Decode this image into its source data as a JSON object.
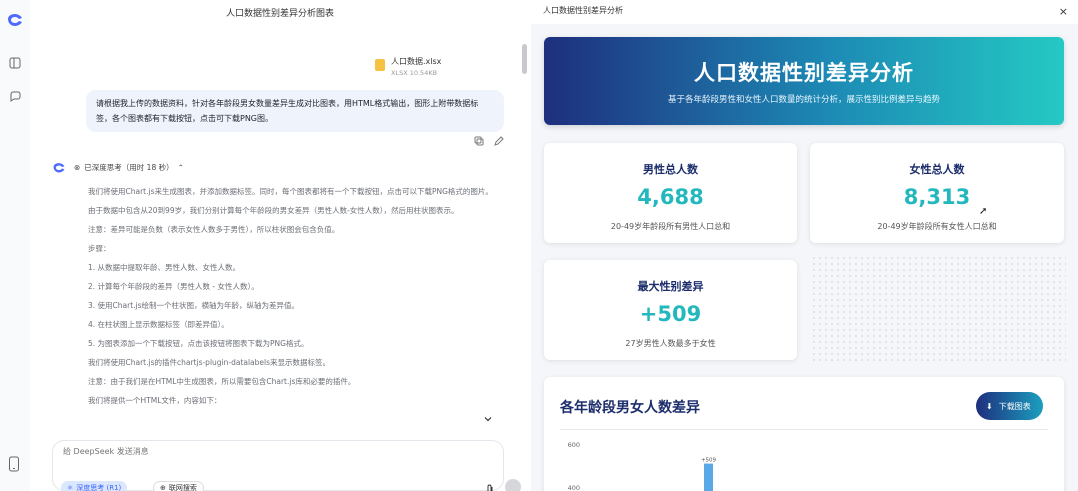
{
  "chat": {
    "window_title": "人口数据性别差异分析图表",
    "file": {
      "name": "人口数据.xlsx",
      "meta": "XLSX 10.54KB"
    },
    "user_message": "请根据我上传的数据资料，针对各年龄段男女数量差异生成对比图表，用HTML格式输出，图形上附带数据标签，各个图表都有下载按钮，点击可下载PNG图。",
    "think_label": "已深度思考（用时 18 秒）",
    "ai_paragraphs": [
      "我们将使用Chart.js来生成图表，并添加数据标签。同时，每个图表都将有一个下载按钮，点击可以下载PNG格式的图片。",
      "由于数据中包含从20到99岁，我们分别计算每个年龄段的男女差异（男性人数-女性人数），然后用柱状图表示。",
      "注意：差异可能是负数（表示女性人数多于男性），所以柱状图会包含负值。",
      "步骤：",
      "1. 从数据中提取年龄、男性人数、女性人数。",
      "2. 计算每个年龄段的差异（男性人数 - 女性人数）。",
      "3. 使用Chart.js绘制一个柱状图，横轴为年龄，纵轴为差异值。",
      "4. 在柱状图上显示数据标签（即差异值）。",
      "5. 为图表添加一个下载按钮，点击该按钮将图表下载为PNG格式。",
      "我们将使用Chart.js的插件chartjs-plugin-datalabels来显示数据标签。",
      "注意：由于我们是在HTML中生成图表，所以需要包含Chart.js库和必要的插件。",
      "我们将提供一个HTML文件，内容如下："
    ],
    "composer_placeholder": "给 DeepSeek 发送消息",
    "chip_deep": "深度思考 (R1)",
    "chip_web": "联网搜索"
  },
  "preview": {
    "title": "人口数据性别差异分析",
    "close": "×",
    "hero_title": "人口数据性别差异分析",
    "hero_subtitle": "基于各年龄段男性和女性人口数量的统计分析，展示性别比例差异与趋势",
    "cards": [
      {
        "label": "男性总人数",
        "value": "4,688",
        "note": "20-49岁年龄段所有男性人口总和"
      },
      {
        "label": "女性总人数",
        "value": "8,313",
        "note": "20-49岁年龄段所有女性人口总和"
      },
      {
        "label": "最大性别差异",
        "value": "+509",
        "note": "27岁男性人数最多于女性"
      }
    ],
    "chart_title": "各年龄段男女人数差异",
    "download_label": "下载图表"
  },
  "colors": {
    "accent": "#22b8bd",
    "navy": "#1c2d6b",
    "bar": "#5aa9e6"
  },
  "chart_data": {
    "type": "bar",
    "title": "各年龄段男女人数差异",
    "y_ticks": [
      "600",
      "400"
    ],
    "ylim": [
      400,
      600
    ],
    "visible_bars": [
      {
        "label": "+509",
        "value": 509
      }
    ]
  }
}
